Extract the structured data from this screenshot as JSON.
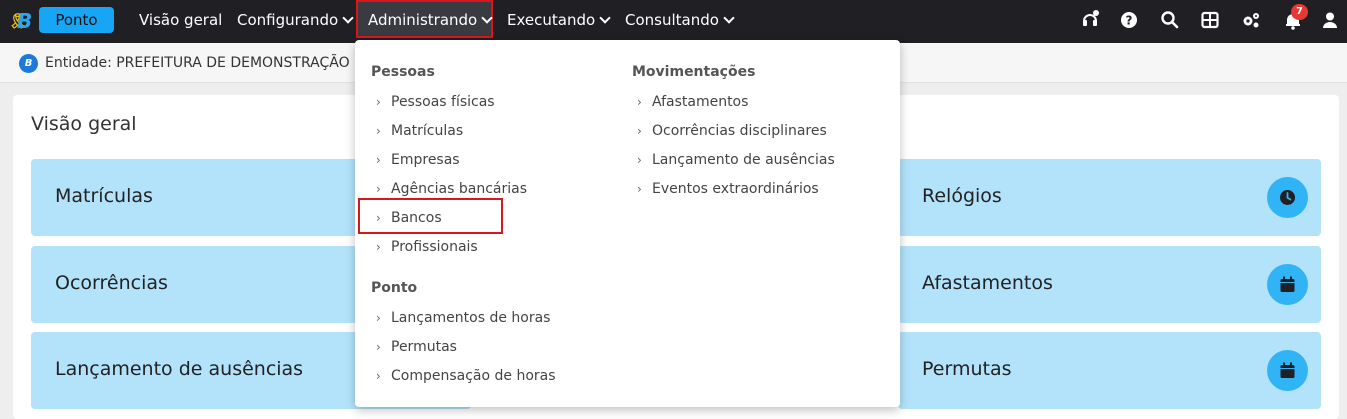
{
  "topbar": {
    "app_name": "Ponto",
    "nav": [
      {
        "label": "Visão geral",
        "has_caret": false
      },
      {
        "label": "Configurando",
        "has_caret": true
      },
      {
        "label": "Administrando",
        "has_caret": true,
        "active": true
      },
      {
        "label": "Executando",
        "has_caret": true
      },
      {
        "label": "Consultando",
        "has_caret": true
      }
    ],
    "notification_count": "7",
    "icons": [
      "headset-icon",
      "help-icon",
      "search-icon",
      "grid-icon",
      "gears-icon",
      "bell-icon",
      "user-icon"
    ]
  },
  "breadcrumb": {
    "badge": "B",
    "text": "Entidade: PREFEITURA DE DEMONSTRAÇÃO DE"
  },
  "main": {
    "title": "Visão geral",
    "tiles_left": [
      "Matrículas",
      "Ocorrências",
      "Lançamento de ausências"
    ],
    "tiles_right": [
      {
        "label": "Relógios",
        "icon": "clock-icon"
      },
      {
        "label": "Afastamentos",
        "icon": "calendar-icon"
      },
      {
        "label": "Permutas",
        "icon": "calendar-icon"
      }
    ]
  },
  "dropdown": {
    "col1": {
      "pessoas_header": "Pessoas",
      "pessoas": [
        "Pessoas físicas",
        "Matrículas",
        "Empresas",
        "Agências bancárias",
        "Bancos",
        "Profissionais"
      ],
      "ponto_header": "Ponto",
      "ponto": [
        "Lançamentos de horas",
        "Permutas",
        "Compensação de horas"
      ]
    },
    "col2": {
      "header": "Movimentações",
      "items": [
        "Afastamentos",
        "Ocorrências disciplinares",
        "Lançamento de ausências",
        "Eventos extraordinários"
      ]
    },
    "highlighted": "Bancos"
  },
  "colors": {
    "topbar": "#1f1f24",
    "accent": "#16a6f5",
    "tile": "#b3e3fb",
    "tile_icon": "#31b4f5",
    "highlight": "#d8171a"
  }
}
